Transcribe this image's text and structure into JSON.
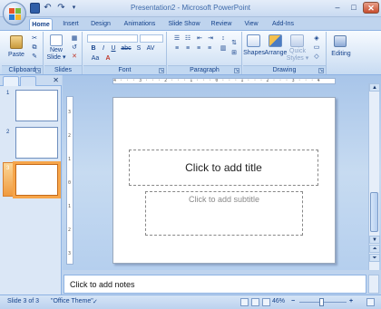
{
  "window": {
    "title": "Presentation2 - Microsoft PowerPoint",
    "minimize": "–",
    "maximize": "□",
    "close": "✕"
  },
  "qat": {
    "undo": "↶",
    "redo": "↷",
    "more": "▾"
  },
  "tabs": [
    "Home",
    "Insert",
    "Design",
    "Animations",
    "Slide Show",
    "Review",
    "View",
    "Add-Ins"
  ],
  "ribbon": {
    "clipboard": {
      "label": "Clipboard",
      "paste": "Paste"
    },
    "slides": {
      "label": "Slides",
      "new_slide_1": "New",
      "new_slide_2": "Slide ▾"
    },
    "font": {
      "label": "Font",
      "bold": "B",
      "italic": "I",
      "underline": "U",
      "strike": "abc",
      "shadow": "S",
      "spacing": "AV",
      "case": "Aa",
      "color": "A"
    },
    "paragraph": {
      "label": "Paragraph"
    },
    "drawing": {
      "label": "Drawing",
      "shapes": "Shapes",
      "arrange": "Arrange",
      "quick_styles_1": "Quick",
      "quick_styles_2": "Styles ▾"
    },
    "editing": {
      "label": "Editing"
    }
  },
  "slides_pane": {
    "numbers": [
      "1",
      "2",
      "3"
    ],
    "selected_index": 3
  },
  "ruler": {
    "horizontal": "4 · · · 3 · · · 2 · · · 1 · · · 0 · · · 1 · · · 2 · · · 3 · · · 4",
    "vertical": [
      "3",
      "2",
      "1",
      "0",
      "1",
      "2",
      "3"
    ]
  },
  "slide": {
    "title_placeholder": "Click to add title",
    "subtitle_placeholder": "Click to add subtitle"
  },
  "notes": {
    "placeholder": "Click to add notes"
  },
  "status": {
    "slide_info": "Slide 3 of 3",
    "theme": "\"Office Theme\"",
    "zoom": "46%",
    "zoom_minus": "−",
    "zoom_plus": "+"
  },
  "colors": {
    "accent": "#15428b",
    "selected_slide": "#f09a3e",
    "ribbon_bg": "#dbe8f7"
  }
}
